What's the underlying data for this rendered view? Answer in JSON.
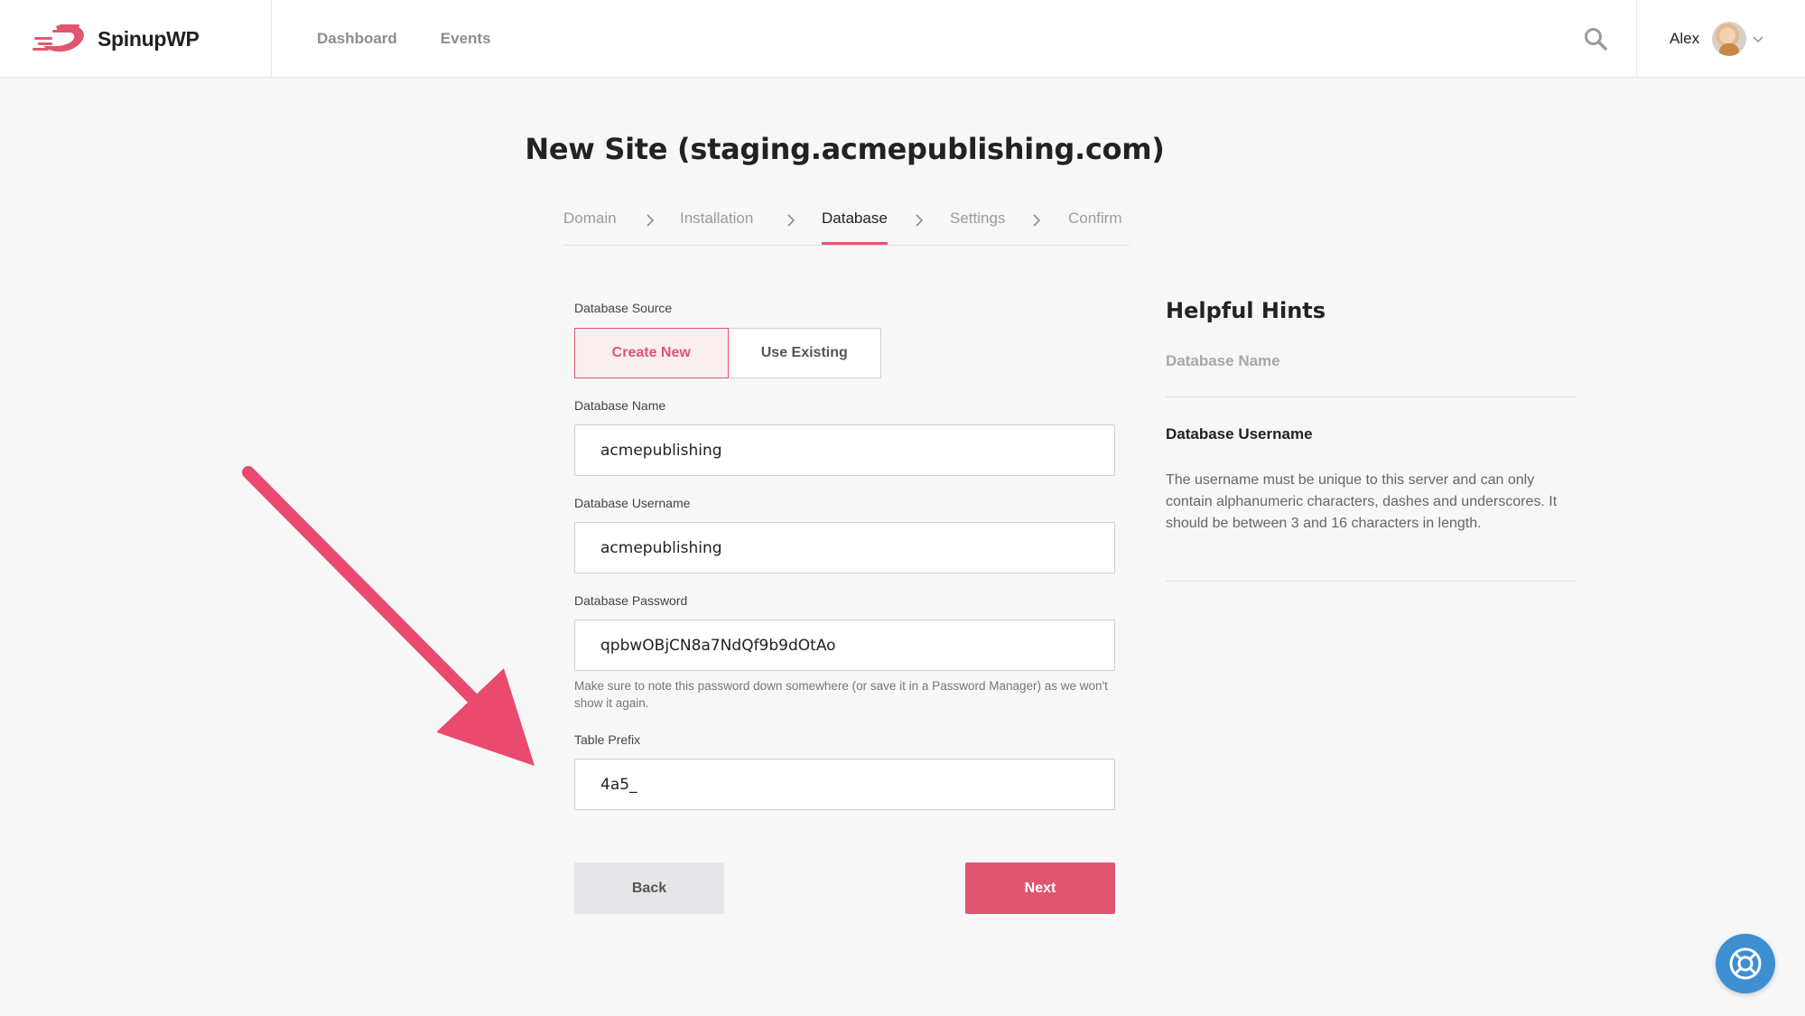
{
  "brand": {
    "name": "SpinupWP",
    "accent": "#e0566f"
  },
  "nav": {
    "items": [
      "Dashboard",
      "Events"
    ]
  },
  "user": {
    "name": "Alex"
  },
  "page": {
    "title": "New Site (staging.acmepublishing.com)"
  },
  "steps": [
    {
      "label": "Domain",
      "active": false
    },
    {
      "label": "Installation",
      "active": false
    },
    {
      "label": "Database",
      "active": true
    },
    {
      "label": "Settings",
      "active": false
    },
    {
      "label": "Confirm",
      "active": false
    }
  ],
  "form": {
    "source_label": "Database Source",
    "source_options": [
      "Create New",
      "Use Existing"
    ],
    "source_selected": "Create New",
    "name_label": "Database Name",
    "name_value": "acmepublishing",
    "username_label": "Database Username",
    "username_value": "acmepublishing",
    "password_label": "Database Password",
    "password_value": "qpbwOBjCN8a7NdQf9b9dOtAo",
    "password_note": "Make sure to note this password down somewhere (or save it in a Password Manager) as we won't show it again.",
    "prefix_label": "Table Prefix",
    "prefix_value": "4a5_",
    "back_label": "Back",
    "next_label": "Next"
  },
  "hints": {
    "title": "Helpful Hints",
    "items": [
      {
        "title": "Database Name",
        "expanded": false
      },
      {
        "title": "Database Username",
        "expanded": true,
        "body": "The username must be unique to this server and can only contain alphanumeric characters, dashes and underscores. It should be between 3 and 16 characters in length."
      }
    ]
  },
  "icons": {
    "search": "search-icon",
    "help": "lifebuoy-icon",
    "chevron": "chevron-right-icon",
    "dropdown": "chevron-down-icon"
  },
  "colors": {
    "help_button": "#3d8fd1",
    "annotation_arrow": "#ea4a6e"
  }
}
